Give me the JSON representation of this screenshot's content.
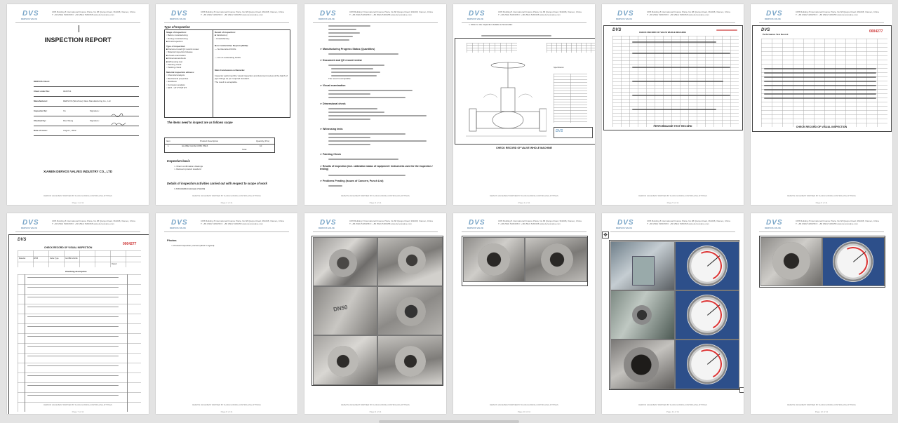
{
  "header": {
    "logo": "DVS",
    "logo_sub": "DERVOS VALVE",
    "address_line1": "C8/5 Building 8 International Finance Plaza, No.68 Qianpu Road, 361008, Xiamen, China",
    "address_line2": "T: +86 (592) 5180158    F: +86 (592) 5180158    www.dervosvalve.com",
    "footer": "DERVOS VALVE BEST PARTNER BY FLUID-FLOWING-CONTROLLING-FITTINGS"
  },
  "pages": [
    {
      "page_label": "Page 1 of 11"
    },
    {
      "page_label": "Page 2 of 11"
    },
    {
      "page_label": "Page 3 of 11"
    },
    {
      "page_label": "Page 4 of 11"
    },
    {
      "page_label": "Page 5 of 11"
    },
    {
      "page_label": "Page 6 of 11"
    },
    {
      "page_label": "Page 7 of 11"
    },
    {
      "page_label": "Page 8 of 11"
    },
    {
      "page_label": "Page 9 of 11"
    },
    {
      "page_label": "Page 10 of 11"
    },
    {
      "page_label": "Page 11 of 11"
    },
    {
      "page_label": "Page 12 of 11"
    }
  ],
  "cover": {
    "title": "INSPECTION REPORT",
    "rows": [
      {
        "label": "DERVOS Client:",
        "value": ""
      },
      {
        "label": "Client order No:",
        "value": "0220711"
      },
      {
        "label": "Manufacturer:",
        "value": "DERVOS (Wenzhou) Valve Manufacturing Co., Ltd"
      },
      {
        "label": "Inspected by:",
        "value": "Xu"
      },
      {
        "label": "Checked by:",
        "value": "Rao Weng"
      },
      {
        "label": "Date of issue:",
        "value": "August , 2022"
      }
    ],
    "signature_label": "Signature:",
    "company": "XIAMEN DERVOS VALVES INDUSTRY CO., LTD"
  },
  "page2": {
    "type_title": "Type of Inspection",
    "stage_title": "Stage of inspection:",
    "stage_items": [
      "Before manufacturing",
      "During manufacturing",
      "Final inspection"
    ],
    "result_title": "Result of inspection:",
    "result_items": [
      "Satisfactory",
      "Unsatisfactory"
    ],
    "type_title2": "Type of inspection:",
    "type_items": [
      "Document and QC record review",
      "Material inspection/release",
      "Visual examination",
      "Dimensional check",
      "Witnessing test",
      "Painting check",
      "Packing check"
    ],
    "ncr_title": "Non Conformities Reports (NCR):",
    "ncr_items": [
      "No Recorded NCRs",
      "List of outstanding NCRs"
    ],
    "material_title": "Material inspection witness:",
    "material_items": [
      "Chemical analysis",
      "Mechanical properties",
      "Hardness",
      "Corrosion analysis",
      "NDT - UT",
      "PT",
      "MT",
      "RT"
    ],
    "conclusion_title": "Main Conclusions & Remarks:",
    "conclusion_text": "Inspector performed the visual inspection and document review of the batch of pipe fittings as per required standard.",
    "conclusion_result": "The result is acceptable.",
    "scope_title": "The items need to inspect are as follows scope",
    "table_header": [
      "Item",
      "Product Description",
      "Quantity (Pcs)"
    ],
    "table_row": [
      "1",
      "GLOBE VALVE DN50 PN16",
      "10"
    ],
    "total_label": "Total",
    "basis_title": "Inspection basis",
    "basis_items": [
      "Client confirmation drawings",
      "Relevant product standard"
    ],
    "details_title": "Details of inspection activities carried out with respect to scope of work",
    "intro_item": "Introduction (scope of work)"
  },
  "page3": {
    "sections": [
      "Manufacturing Progress Status (Quantities)",
      "Document and QC record review",
      "Visual examination",
      "Dimensional check",
      "Witnessing tests",
      "Painting Check",
      "Results of Inspection (incl. calibration status of equipment / Instruments used for the inspection / testing)",
      "Problems Pending (Issues of Concern, Punch List)"
    ],
    "result_note": "The result is acceptable."
  },
  "page4": {
    "note": "Refer to the Inspection details as hereinafter.",
    "caption": "CHECK RECORD OF VALVE WHOLE MACHINE"
  },
  "page5": {
    "form_title": "CHECK RECORD OF VALVE WHOLE MACHINE",
    "caption": "PERFORMANCE TEST RECORD"
  },
  "page6": {
    "form_title": "Performance Test Record",
    "serial": "0004277",
    "caption": "CHECK RECORD OF VISUAL INSPECTION"
  },
  "page7": {
    "form_title": "CHECK RECORD OF VISUAL INSPECTION",
    "serial": "0004277",
    "checking_header": "Checking description",
    "material_label": "Material",
    "material_value": "WCB",
    "valve_type_label": "Valve Type",
    "valve_type_value": "GLOBE VALVE",
    "result_label": "Result"
  },
  "page8": {
    "photos_title": "Photos",
    "photos_item": "Product Inspection process (which I signed)"
  },
  "photo_pages": {
    "stamp": "DN50"
  }
}
